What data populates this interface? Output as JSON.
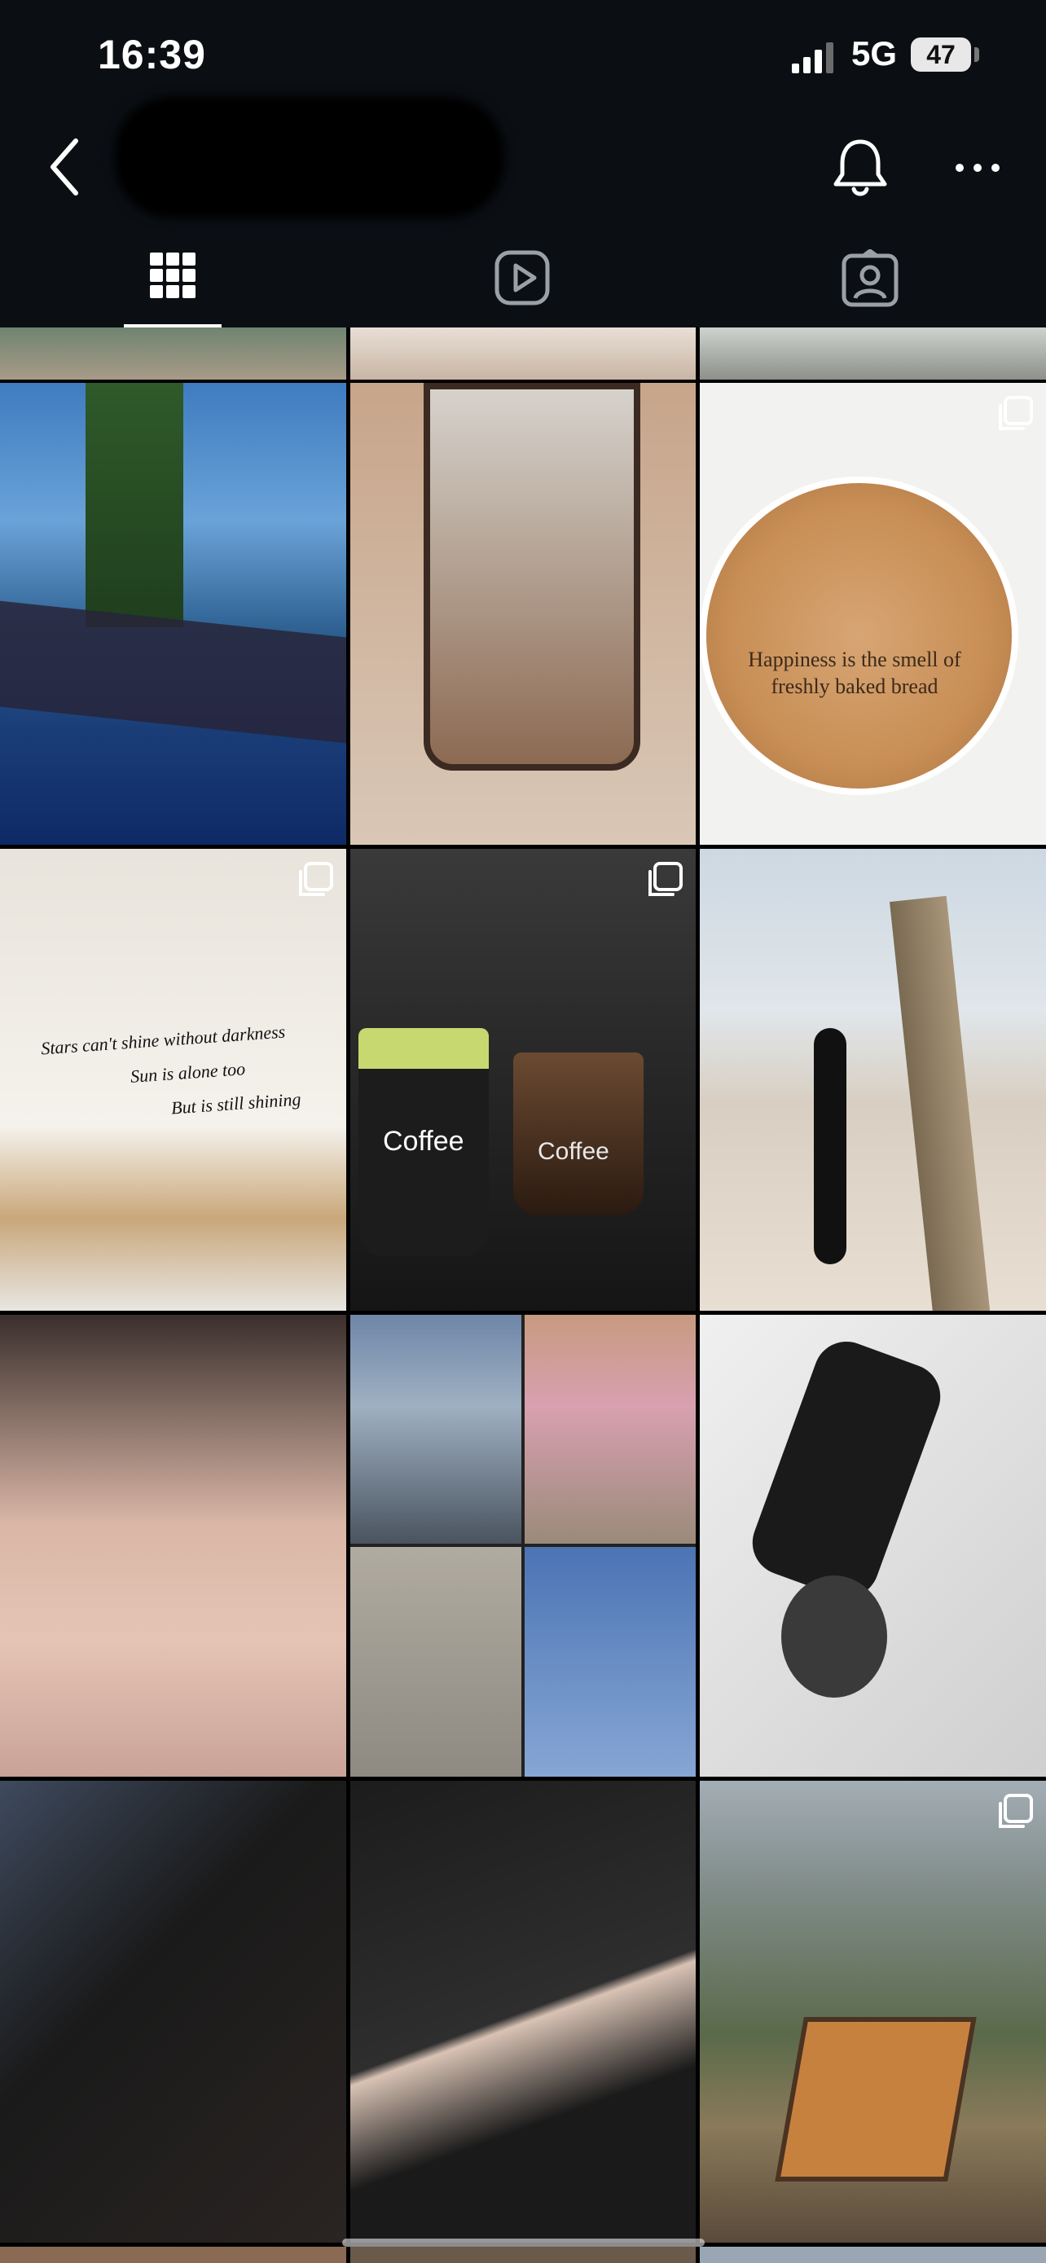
{
  "status_bar": {
    "time": "16:39",
    "network": "5G",
    "battery": "47"
  },
  "header": {
    "back_icon": "chevron-left-icon",
    "notifications_icon": "bell-icon",
    "more_icon": "more-horizontal-icon"
  },
  "tabs": [
    {
      "name": "grid",
      "icon": "grid-icon",
      "selected": true
    },
    {
      "name": "reels",
      "icon": "play-icon",
      "selected": false
    },
    {
      "name": "tagged",
      "icon": "person-tag-icon",
      "selected": false
    }
  ],
  "posts": {
    "bread_caption": "Happiness is the smell of",
    "bread_caption_2": "freshly baked bread",
    "wall_line_1": "Stars can't shine without darkness",
    "wall_line_2": "Sun is alone too",
    "wall_line_3": "But is still shining",
    "cup_1": "Coffee",
    "cup_2": "Coffee"
  },
  "colors": {
    "background": "#0b0f14",
    "accent": "#ffffff"
  }
}
